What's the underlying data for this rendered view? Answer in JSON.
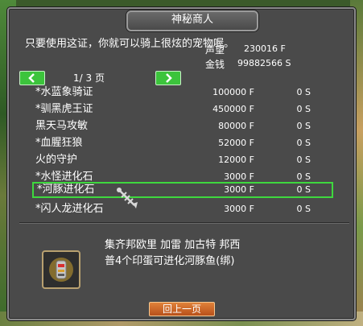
{
  "window": {
    "title": "神秘商人"
  },
  "hint": "只要使用这证，你就可以骑上很炫的宠物喔。",
  "stats": {
    "prestige_label": "声望",
    "prestige_value": "230016 F",
    "money_label": "金钱",
    "money_value": "99882566 S"
  },
  "pagination": {
    "current": "1/ 3 页"
  },
  "items": [
    {
      "name": "*水蓝象骑证",
      "price": "100000 F",
      "score": "0 S"
    },
    {
      "name": "*驯黑虎王证",
      "price": "450000 F",
      "score": "0 S"
    },
    {
      "name": "黑天马攻敏",
      "price": "80000 F",
      "score": "0 S"
    },
    {
      "name": "*血腥狂狼",
      "price": "52000 F",
      "score": "0 S"
    },
    {
      "name": "火的守护",
      "price": "12000 F",
      "score": "0 S"
    },
    {
      "name": "*水怪进化石",
      "price": "3000 F",
      "score": "0 S"
    },
    {
      "name": "*河豚进化石",
      "price": "3000 F",
      "score": "0 S",
      "selected": true
    },
    {
      "name": "*闪人龙进化石",
      "price": "3000 F",
      "score": "0 S"
    }
  ],
  "description": {
    "line1": "集齐邦欧里 加雷 加古特 邦西",
    "line2": "普4个印蛋可进化河豚鱼(绑)"
  },
  "buttons": {
    "back": "回上一页"
  },
  "colors": {
    "panel": "#4a4a4a",
    "nav_green": "#3cc43c",
    "selection": "#3ed83e",
    "back_orange": "#d06a2a"
  },
  "icons": {
    "prev": "arrow-left-icon",
    "next": "arrow-right-icon",
    "cursor": "fishbone-cursor-icon",
    "item": "evolution-stone-icon"
  }
}
